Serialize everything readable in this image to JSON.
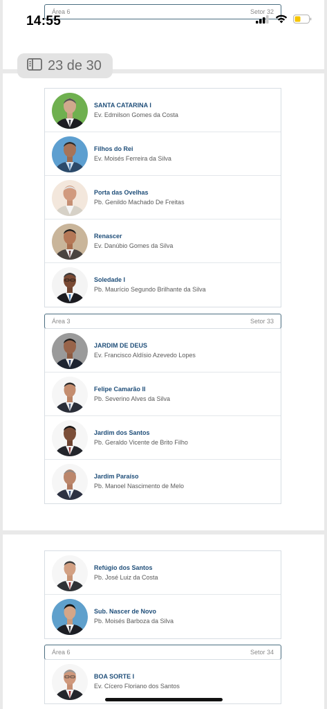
{
  "status_bar": {
    "time": "14:55",
    "battery_color": "#f5c400"
  },
  "page_indicator": {
    "label": "23 de 30",
    "icon": "sidebar-icon"
  },
  "top_header": {
    "area": "Área 6",
    "setor": "Setor 32"
  },
  "group1": {
    "rows": [
      {
        "church": "SANTA CATARINA I",
        "pastor": "Ev. Edmilson Gomes da Costa"
      },
      {
        "church": "Filhos do Rei",
        "pastor": "Ev. Moisés Ferreira da Silva"
      },
      {
        "church": "Porta das Ovelhas",
        "pastor": "Pb. Genildo Machado De Freitas"
      },
      {
        "church": "Renascer",
        "pastor": "Ev. Danúbio Gomes da Silva"
      },
      {
        "church": "Soledade I",
        "pastor": "Pb. Maurício Segundo Brilhante da Silva"
      }
    ]
  },
  "header2": {
    "area": "Área 3",
    "setor": "Setor 33"
  },
  "group2": {
    "rows": [
      {
        "church": "JARDIM DE DEUS",
        "pastor": "Ev. Francisco Aldísio Azevedo Lopes"
      },
      {
        "church": "Felipe Camarão II",
        "pastor": "Pb. Severino Alves da Silva"
      },
      {
        "church": "Jardim dos Santos",
        "pastor": "Pb. Geraldo Vicente de Brito Filho"
      },
      {
        "church": "Jardim Paraíso",
        "pastor": "Pb. Manoel Nascimento de Melo"
      }
    ]
  },
  "group3": {
    "rows": [
      {
        "church": "Refúgio dos Santos",
        "pastor": "Pb. José Luiz da Costa"
      },
      {
        "church": "Sub. Nascer de Novo",
        "pastor": "Pb. Moisés Barboza da Silva"
      }
    ]
  },
  "header3": {
    "area": "Área 6",
    "setor": "Setor 34"
  },
  "group4": {
    "rows": [
      {
        "church": "BOA SORTE I",
        "pastor": "Ev. Cícero Floriano dos Santos"
      }
    ]
  }
}
